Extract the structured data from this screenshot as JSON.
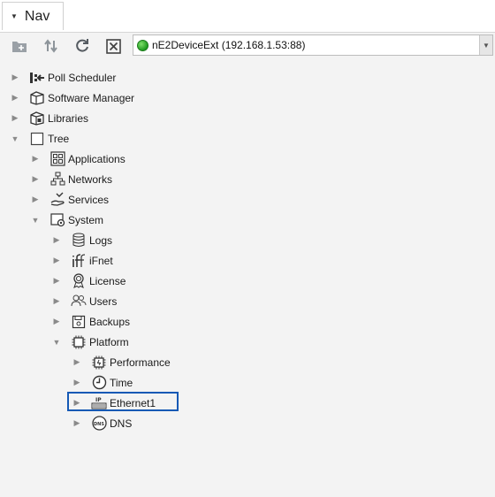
{
  "tab": {
    "title": "Nav"
  },
  "toolbar": {
    "ord": "nE2DeviceExt (192.168.1.53:88)",
    "buttons": [
      "new-folder-icon",
      "sort-icon",
      "refresh-icon",
      "close-box-icon"
    ]
  },
  "tree": {
    "poll_scheduler": "Poll Scheduler",
    "software_manager": "Software Manager",
    "libraries": "Libraries",
    "tree": "Tree",
    "applications": "Applications",
    "networks": "Networks",
    "services": "Services",
    "system": "System",
    "logs": "Logs",
    "ifnet": "iFnet",
    "license": "License",
    "users": "Users",
    "backups": "Backups",
    "platform": "Platform",
    "performance": "Performance",
    "time": "Time",
    "ethernet1": "Ethernet1",
    "dns": "DNS"
  },
  "selection": {
    "selected_item": "Ethernet1",
    "highlight_color": "#1559b5"
  },
  "colors": {
    "status_dot": "#1f9a1f",
    "panel_bg": "#f3f3f3"
  }
}
